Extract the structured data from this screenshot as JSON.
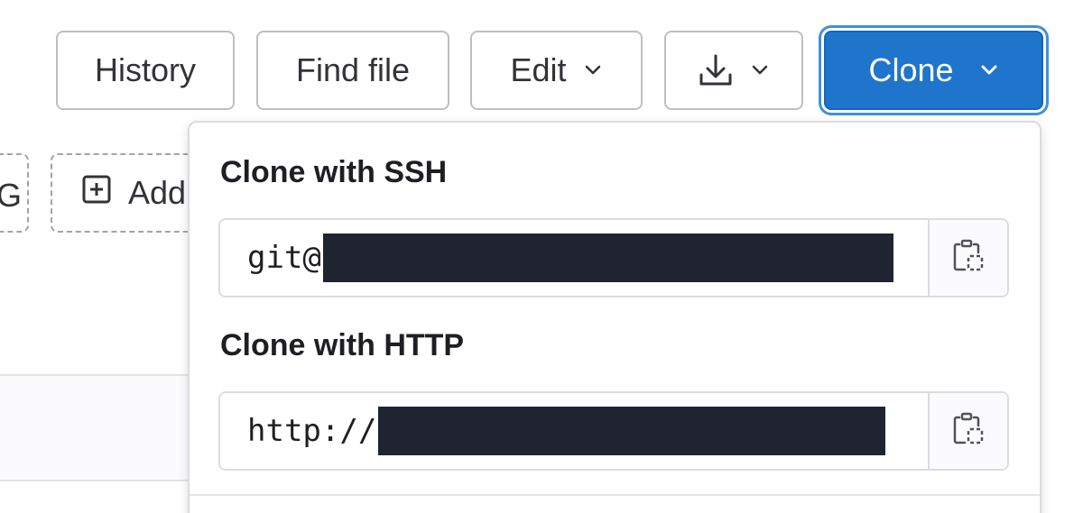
{
  "toolbar": {
    "history_label": "History",
    "find_file_label": "Find file",
    "edit_label": "Edit",
    "clone_label": "Clone"
  },
  "background": {
    "partial_left_label": "G",
    "add_label": "Add"
  },
  "clone_dropdown": {
    "ssh_title": "Clone with SSH",
    "ssh_value_prefix": "git@",
    "http_title": "Clone with HTTP",
    "http_value_prefix": "http://"
  },
  "icons": {
    "download": "download-icon",
    "chevron": "chevron-down-icon",
    "copy": "copy-to-clipboard-icon",
    "add": "plus-square-icon"
  },
  "colors": {
    "clone_button": "#1f75cb",
    "focus_ring": "#428fdc",
    "redaction": "#1f2430"
  }
}
